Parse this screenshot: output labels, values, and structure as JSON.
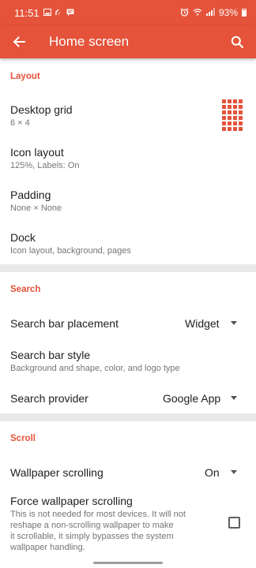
{
  "status_bar": {
    "time": "11:51",
    "battery": "93%",
    "icons": [
      "image-icon",
      "signal-r-icon",
      "message-icon",
      "alarm-icon",
      "wifi-icon",
      "cell-signal-icon",
      "battery-icon"
    ]
  },
  "app_bar": {
    "title": "Home screen",
    "back_icon": "arrow-back-icon",
    "search_icon": "search-icon",
    "color": "#e4533a"
  },
  "sections": {
    "layout": {
      "header": "Layout",
      "desktop_grid": {
        "title": "Desktop grid",
        "subtitle": "6 × 4",
        "icon": "grid-icon"
      },
      "icon_layout": {
        "title": "Icon layout",
        "subtitle": "125%, Labels: On"
      },
      "padding": {
        "title": "Padding",
        "subtitle": "None × None"
      },
      "dock": {
        "title": "Dock",
        "subtitle": "Icon layout, background, pages"
      }
    },
    "search": {
      "header": "Search",
      "placement": {
        "title": "Search bar placement",
        "value": "Widget"
      },
      "style": {
        "title": "Search bar style",
        "subtitle": "Background and shape, color, and logo type"
      },
      "provider": {
        "title": "Search provider",
        "value": "Google App"
      }
    },
    "scroll": {
      "header": "Scroll",
      "wallpaper_scrolling": {
        "title": "Wallpaper scrolling",
        "value": "On"
      },
      "force_wallpaper_scrolling": {
        "title": "Force wallpaper scrolling",
        "subtitle_lines": [
          "This is not needed for most devices. It will not",
          "reshape a non-scrolling wallpaper to make",
          "it scrollable, it simply bypasses the system",
          "wallpaper handling."
        ],
        "checked": false
      }
    }
  },
  "accent_color": "#e4533a"
}
